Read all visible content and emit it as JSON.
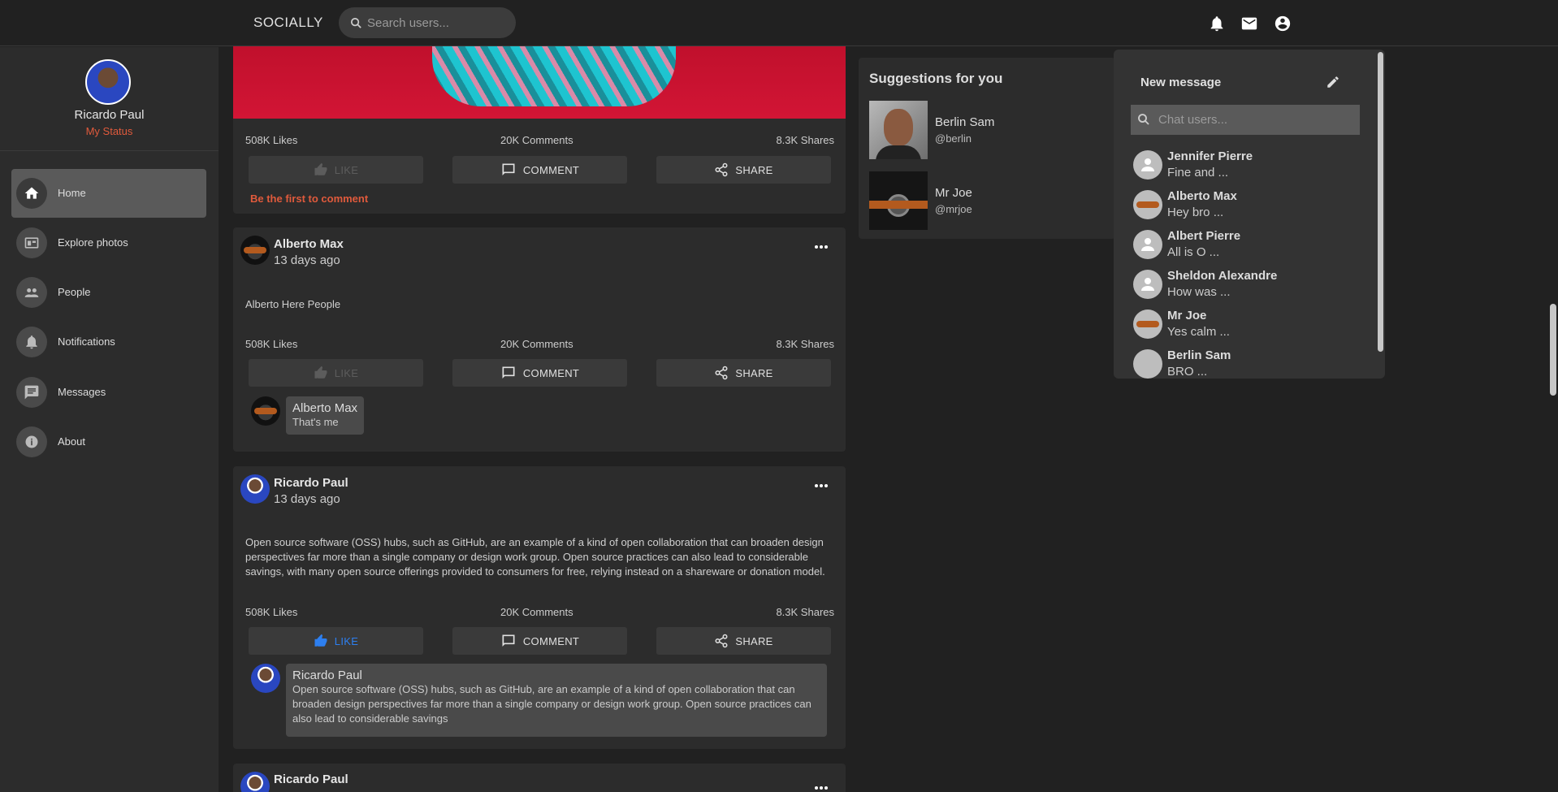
{
  "header": {
    "brand": "SOCIALLY",
    "search_placeholder": "Search users..."
  },
  "sidebar": {
    "profile_name": "Ricardo Paul",
    "profile_status": "My Status",
    "items": [
      {
        "label": "Home",
        "icon": "home-icon",
        "active": true
      },
      {
        "label": "Explore photos",
        "icon": "photo-icon"
      },
      {
        "label": "People",
        "icon": "people-icon"
      },
      {
        "label": "Notifications",
        "icon": "bell-icon"
      },
      {
        "label": "Messages",
        "icon": "chat-icon"
      },
      {
        "label": "About",
        "icon": "info-icon"
      }
    ]
  },
  "actions": {
    "like": "LIKE",
    "comment": "COMMENT",
    "share": "SHARE"
  },
  "posts": [
    {
      "likes": "508K Likes",
      "comments": "20K Comments",
      "shares": "8.3K Shares",
      "empty_comment": "Be the first to comment"
    },
    {
      "author": "Alberto Max",
      "time": "13 days ago",
      "text": "Alberto Here People",
      "likes": "508K Likes",
      "comments": "20K Comments",
      "shares": "8.3K Shares",
      "comment": {
        "author": "Alberto Max",
        "text": "That's me"
      }
    },
    {
      "author": "Ricardo Paul",
      "time": "13 days ago",
      "text": "Open source software (OSS) hubs, such as GitHub, are an example of a kind of open collaboration that can broaden design perspectives far more than a single company or design work group. Open source practices can also lead to considerable savings, with many open source offerings provided to consumers for free, relying instead on a shareware or donation model.",
      "likes": "508K Likes",
      "comments": "20K Comments",
      "shares": "8.3K Shares",
      "comment": {
        "author": "Ricardo Paul",
        "text": "Open source software (OSS) hubs, such as GitHub, are an example of a kind of open collaboration that can broaden design perspectives far more than a single company or design work group. Open source practices can also lead to considerable savings"
      }
    },
    {
      "author": "Ricardo Paul"
    }
  ],
  "suggestions": {
    "title": "Suggestions for you",
    "users": [
      {
        "name": "Berlin Sam",
        "handle": "@berlin"
      },
      {
        "name": "Mr Joe",
        "handle": "@mrjoe"
      }
    ]
  },
  "messages": {
    "title": "New message",
    "search_placeholder": "Chat users...",
    "chats": [
      {
        "name": "Jennifer Pierre",
        "snippet": "Fine and ..."
      },
      {
        "name": "Alberto Max",
        "snippet": "Hey bro ..."
      },
      {
        "name": "Albert Pierre",
        "snippet": "All is O ..."
      },
      {
        "name": "Sheldon Alexandre",
        "snippet": "How was ..."
      },
      {
        "name": "Mr Joe",
        "snippet": "Yes calm ..."
      },
      {
        "name": "Berlin Sam",
        "snippet": "BRO ..."
      }
    ]
  },
  "colors": {
    "accent_status": "#e05a3c",
    "like_active": "#2d7ff0"
  }
}
